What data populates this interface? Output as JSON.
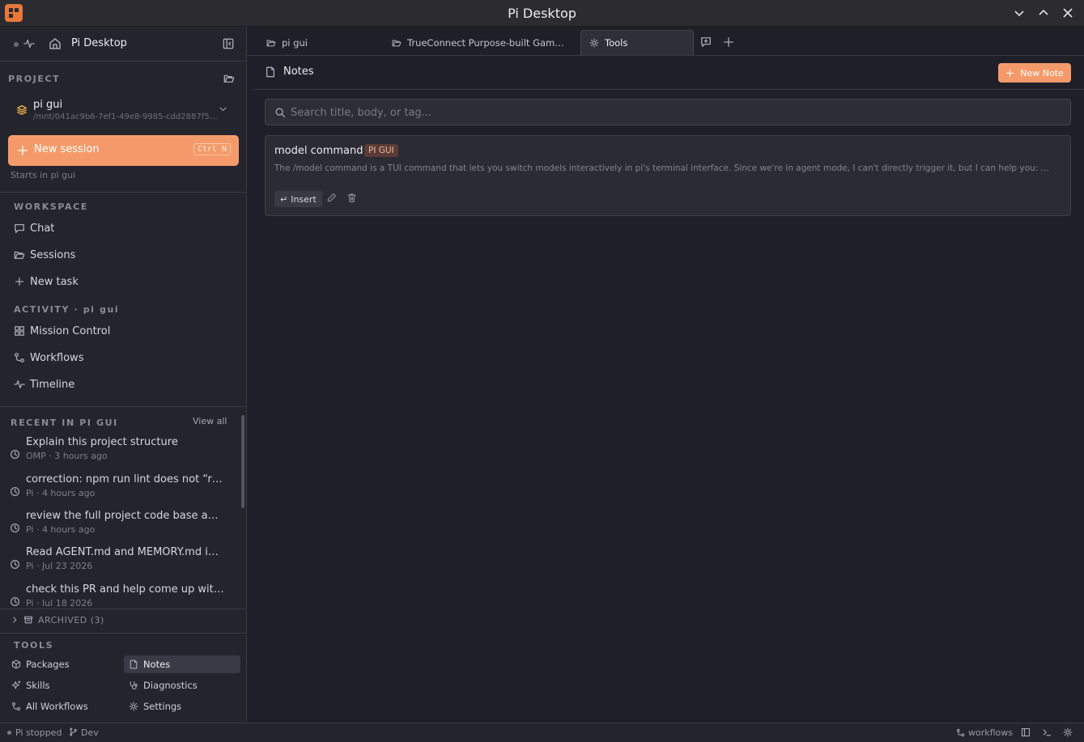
{
  "window": {
    "title": "Pi Desktop"
  },
  "sidebar": {
    "home_label": "Pi Desktop",
    "project_section": "PROJECT",
    "project": {
      "name": "pi gui",
      "path": "/mnt/041ac9b6-7ef1-49e8-9985-cdd2887f5…"
    },
    "new_session": {
      "label": "New session",
      "shortcut": "Ctrl N",
      "hint": "Starts in pi gui"
    },
    "workspace_section": "WORKSPACE",
    "workspace_items": [
      {
        "label": "Chat",
        "icon": "chat-icon"
      },
      {
        "label": "Sessions",
        "icon": "folder-icon"
      },
      {
        "label": "New task",
        "icon": "plus-icon"
      }
    ],
    "activity_section": "ACTIVITY · pi gui",
    "activity_items": [
      {
        "label": "Mission Control",
        "icon": "grid-icon"
      },
      {
        "label": "Workflows",
        "icon": "workflow-icon"
      },
      {
        "label": "Timeline",
        "icon": "activity-icon"
      }
    ],
    "recent": {
      "heading": "RECENT IN PI GUI",
      "view_all": "View all",
      "items": [
        {
          "title": "Explain this project structure",
          "meta": "OMP · 3 hours ago"
        },
        {
          "title": "correction: npm run lint does not “r…",
          "meta": "Pi · 4 hours ago"
        },
        {
          "title": "review the full project code base a…",
          "meta": "Pi · 4 hours ago"
        },
        {
          "title": "Read AGENT.md and MEMORY.md i…",
          "meta": "Pi · Jul 23 2026"
        },
        {
          "title": "check this PR and help come up wit…",
          "meta": "Pi · Jul 18 2026"
        }
      ]
    },
    "archived_label": "ARCHIVED (3)",
    "tools_section": "TOOLS",
    "tools": [
      {
        "label": "Packages",
        "icon": "package-icon"
      },
      {
        "label": "Notes",
        "icon": "note-icon",
        "active": true
      },
      {
        "label": "Skills",
        "icon": "sparkle-icon"
      },
      {
        "label": "Diagnostics",
        "icon": "stethoscope-icon"
      },
      {
        "label": "All Workflows",
        "icon": "workflow-icon"
      },
      {
        "label": "Settings",
        "icon": "gear-icon"
      }
    ]
  },
  "tabs": [
    {
      "label": "pi gui",
      "icon": "folder-icon"
    },
    {
      "label": "TrueConnect Purpose-built Gam…",
      "icon": "folder-icon"
    },
    {
      "label": "Tools",
      "icon": "gear-icon",
      "active": true
    }
  ],
  "notes": {
    "header": "Notes",
    "new_note_label": "New Note",
    "search_placeholder": "Search title, body, or tag...",
    "items": [
      {
        "title": "model command",
        "tag": "PI GUI",
        "body": "The /model command is a TUI command that lets you switch models interactively in pi's terminal interface. Since we're in agent mode, I can't directly trigger it, but I can help you: …",
        "insert_label": "Insert"
      }
    ]
  },
  "statusbar": {
    "pi_status": "Pi stopped",
    "branch": "Dev",
    "workflows": "workflows"
  },
  "colors": {
    "accent": "#f49a6a",
    "background": "#1f1f29",
    "sidebar": "#24242d"
  }
}
